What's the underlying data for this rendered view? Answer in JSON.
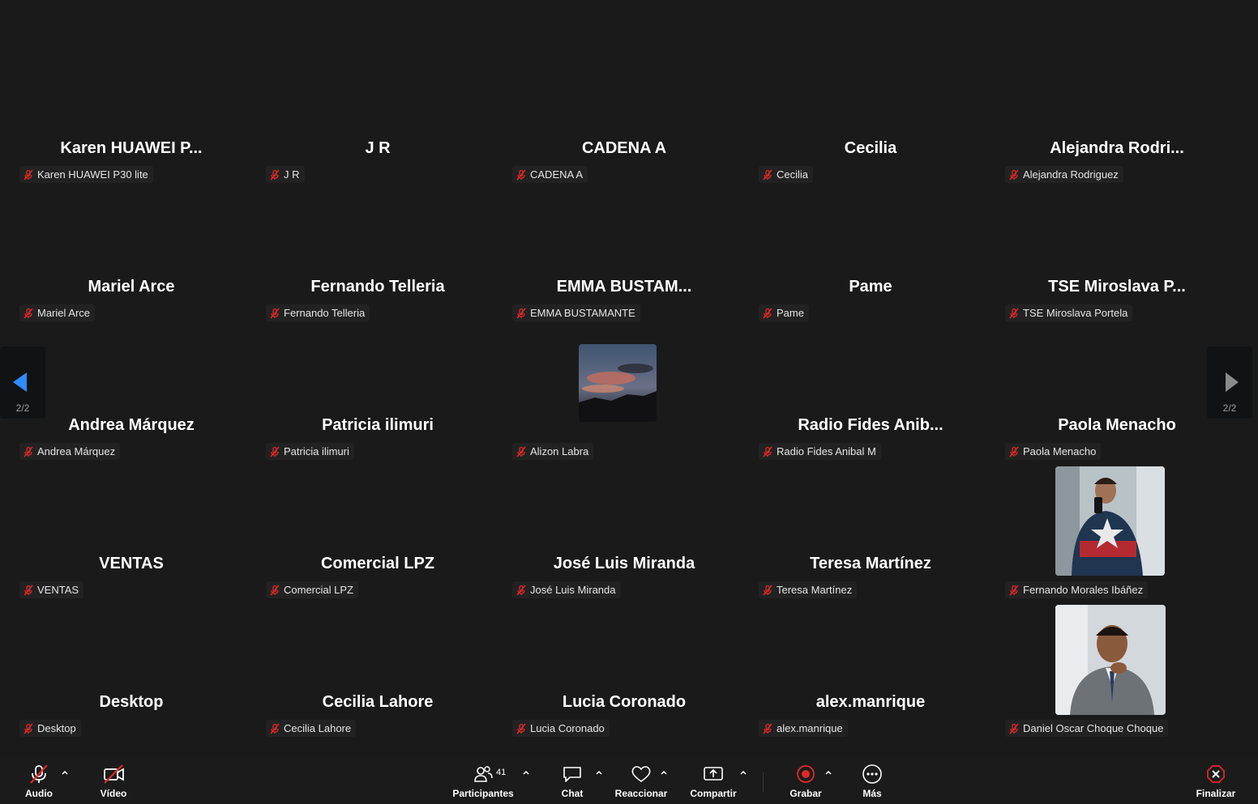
{
  "tiles": [
    {
      "name": "Karen HUAWEI P...",
      "label": "Karen HUAWEI P30 lite"
    },
    {
      "name": "J R",
      "label": "J R"
    },
    {
      "name": "CADENA A",
      "label": "CADENA A"
    },
    {
      "name": "Cecilia",
      "label": "Cecilia"
    },
    {
      "name": "Alejandra  Rodri...",
      "label": "Alejandra Rodriguez"
    },
    {
      "name": "Mariel Arce",
      "label": "Mariel Arce"
    },
    {
      "name": "Fernando Telleria",
      "label": "Fernando Telleria"
    },
    {
      "name": "EMMA  BUSTAM...",
      "label": "EMMA BUSTAMANTE"
    },
    {
      "name": "Pame",
      "label": "Pame"
    },
    {
      "name": "TSE Miroslava  P...",
      "label": "TSE Miroslava Portela"
    },
    {
      "name": "Andrea Márquez",
      "label": "Andrea Márquez"
    },
    {
      "name": "Patricia ilimuri",
      "label": "Patricia ilimuri"
    },
    {
      "name": "",
      "label": "Alizon Labra"
    },
    {
      "name": "Radio  Fides  Anib...",
      "label": "Radio Fides Anibal M"
    },
    {
      "name": "Paola Menacho",
      "label": "Paola Menacho"
    },
    {
      "name": "VENTAS",
      "label": "VENTAS"
    },
    {
      "name": "Comercial LPZ",
      "label": "Comercial LPZ"
    },
    {
      "name": "José Luis Miranda",
      "label": "José Luis Miranda"
    },
    {
      "name": "Teresa Martínez",
      "label": "Teresa Martínez"
    },
    {
      "name": "",
      "label": "Fernando Morales Ibáñez"
    },
    {
      "name": "Desktop",
      "label": "Desktop"
    },
    {
      "name": "Cecilia Lahore",
      "label": "Cecilia Lahore"
    },
    {
      "name": "Lucia  Coronado",
      "label": "Lucia  Coronado"
    },
    {
      "name": "alex.manrique",
      "label": "alex.manrique"
    },
    {
      "name": "",
      "label": "Daniel Oscar Choque Choque"
    }
  ],
  "pagination": {
    "left": "2/2",
    "right": "2/2"
  },
  "toolbar": {
    "audio": "Audio",
    "video": "Vídeo",
    "participants": "Participantes",
    "participants_count": "41",
    "chat": "Chat",
    "react": "Reaccionar",
    "share": "Compartir",
    "record": "Grabar",
    "more": "Más",
    "end": "Finalizar"
  },
  "colors": {
    "background": "#1a1a1a",
    "mute_red": "#e02828",
    "record_red": "#e02828",
    "nav_arrow_blue": "#2d8cff"
  }
}
